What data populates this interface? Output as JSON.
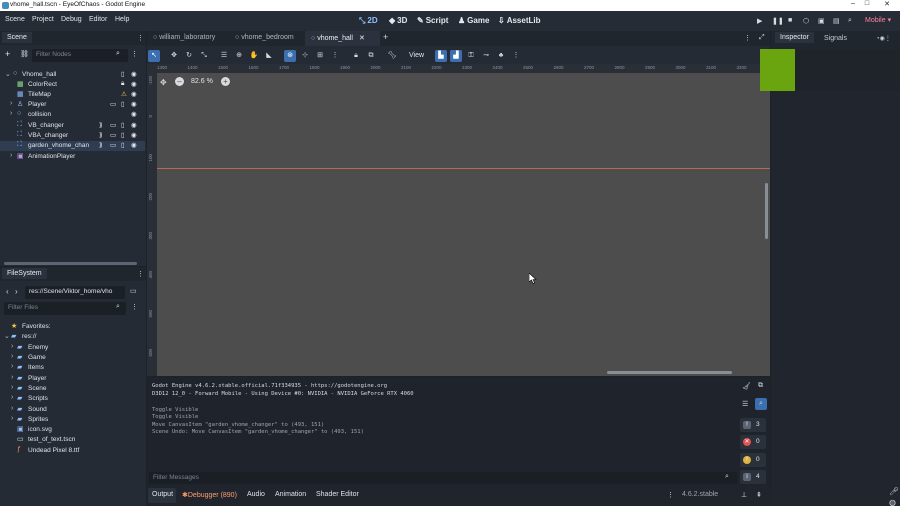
{
  "window": {
    "title": "vhome_hall.tscn - EyeOfChaos - Godot Engine",
    "minimize": "–",
    "maximize": "□",
    "close": "✕"
  },
  "menu": [
    "Scene",
    "Project",
    "Debug",
    "Editor",
    "Help"
  ],
  "workspaces": [
    {
      "label": "2D",
      "icon": "2d-icon"
    },
    {
      "label": "3D",
      "icon": "3d-icon"
    },
    {
      "label": "Script",
      "icon": "script-icon"
    },
    {
      "label": "Game",
      "icon": "game-icon"
    },
    {
      "label": "AssetLib",
      "icon": "assetlib-icon"
    }
  ],
  "renderer": "Mobile",
  "scene_dock": {
    "tab": "Scene",
    "filter_placeholder": "Filter Nodes",
    "nodes": [
      {
        "name": "Vhome_hall",
        "color": "#8fbfff"
      },
      {
        "name": "ColorRect",
        "color": "#8fe38f"
      },
      {
        "name": "TileMap",
        "color": "#8fbfff"
      },
      {
        "name": "Player",
        "color": "#8fbfff"
      },
      {
        "name": "collision",
        "color": "#8fbfff"
      },
      {
        "name": "VB_changer",
        "color": "#8fbfff"
      },
      {
        "name": "VBA_changer",
        "color": "#8fbfff"
      },
      {
        "name": "garden_vhome_chan",
        "color": "#8fbfff"
      },
      {
        "name": "AnimationPlayer",
        "color": "#c09bf0"
      }
    ]
  },
  "filesystem_dock": {
    "tab": "FileSystem",
    "path": "res://Scene/Viktor_home/vho",
    "filter_placeholder": "Filter Files",
    "favorites": "Favorites:",
    "root": "res://",
    "items": [
      {
        "name": "Enemy",
        "type": "folder"
      },
      {
        "name": "Game",
        "type": "folder"
      },
      {
        "name": "Items",
        "type": "folder"
      },
      {
        "name": "Player",
        "type": "folder"
      },
      {
        "name": "Scene",
        "type": "folder"
      },
      {
        "name": "Scripts",
        "type": "folder"
      },
      {
        "name": "Sound",
        "type": "folder"
      },
      {
        "name": "Sprites",
        "type": "folder"
      },
      {
        "name": "icon.svg",
        "type": "image"
      },
      {
        "name": "test_of_text.tscn",
        "type": "scene"
      },
      {
        "name": "Undead Pixel 8.ttf",
        "type": "font"
      }
    ]
  },
  "scene_tabs": [
    "william_laboratory",
    "vhome_bedroom",
    "vhome_hall"
  ],
  "add_tab": "+",
  "toolbar": {
    "view_label": "View"
  },
  "viewport": {
    "zoom": "82.6 %",
    "zoom_minus": "–",
    "zoom_plus": "+"
  },
  "ruler_h": [
    "1300",
    "1400",
    "1500",
    "1600",
    "1700",
    "1800",
    "1900",
    "2000",
    "2100",
    "2200",
    "2300",
    "2400",
    "2500",
    "2600",
    "2700",
    "2800",
    "2900",
    "3000",
    "3100",
    "3200",
    "3300"
  ],
  "ruler_v": [
    "-100",
    "0",
    "100",
    "200",
    "300",
    "400",
    "500",
    "600",
    "700"
  ],
  "console": {
    "lines": [
      "Godot Engine v4.6.2.stable.official.71f334935 - https://godotengine.org",
      "D3D12 12_0 - Forward Mobile - Using Device #0: NVIDIA - NVIDIA GeForce RTX 4060",
      "",
      "Toggle Visible",
      "Toggle Visible",
      "Move CanvasItem \"garden_vhome_changer\" to (493, 151)",
      "Scene Undo: Move CanvasItem \"garden_vhome_changer\" to (493, 151)"
    ],
    "filter_placeholder": "Filter Messages",
    "counts": [
      "3",
      "0",
      "0",
      "4"
    ]
  },
  "bottom_tabs": [
    "Output",
    "Debugger (890)",
    "Audio",
    "Animation",
    "Shader Editor"
  ],
  "version": "4.6.2.stable",
  "inspector": {
    "tabs": [
      "Inspector",
      "Signals"
    ]
  }
}
